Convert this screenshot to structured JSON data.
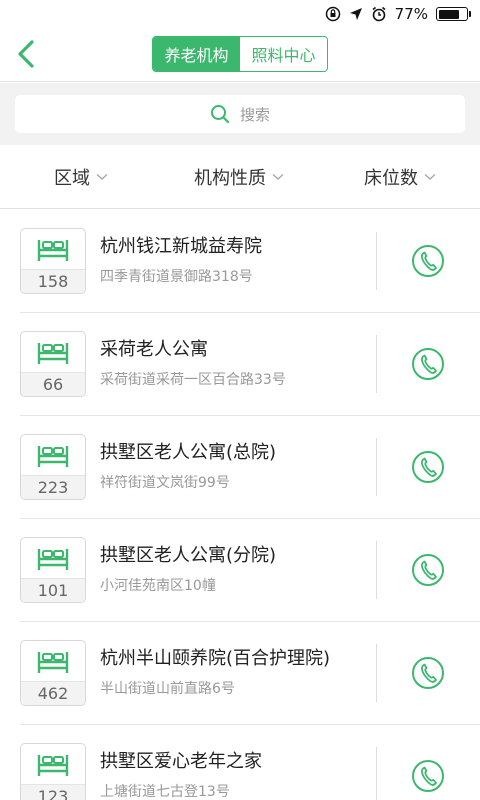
{
  "status_bar": {
    "battery_text": "77%",
    "battery_level": 0.77
  },
  "header": {
    "back_icon": "chevron-left-icon",
    "tabs": [
      {
        "label": "养老机构",
        "active": true
      },
      {
        "label": "照料中心",
        "active": false
      }
    ]
  },
  "search": {
    "icon": "search-icon",
    "placeholder": "搜索"
  },
  "filters": [
    {
      "label": "区域"
    },
    {
      "label": "机构性质"
    },
    {
      "label": "床位数"
    }
  ],
  "colors": {
    "accent": "#3cb86e",
    "text_secondary": "#999999"
  },
  "institutions": [
    {
      "beds": "158",
      "name": "杭州钱江新城益寿院",
      "address": "四季青街道景御路318号"
    },
    {
      "beds": "66",
      "name": "采荷老人公寓",
      "address": "采荷街道采荷一区百合路33号"
    },
    {
      "beds": "223",
      "name": "拱墅区老人公寓(总院)",
      "address": "祥符街道文岚街99号"
    },
    {
      "beds": "101",
      "name": "拱墅区老人公寓(分院)",
      "address": "小河佳苑南区10幢"
    },
    {
      "beds": "462",
      "name": "杭州半山颐养院(百合护理院)",
      "address": "半山街道山前直路6号"
    },
    {
      "beds": "123",
      "name": "拱墅区爱心老年之家",
      "address": "上塘街道七古登13号"
    }
  ]
}
